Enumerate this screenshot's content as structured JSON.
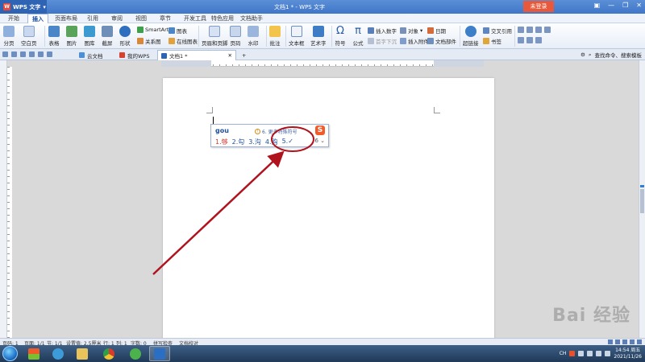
{
  "window": {
    "app_name": "WPS 文字",
    "title": "文档1 * - WPS 文字",
    "login_label": "未登录"
  },
  "ribbon_tabs": [
    "开始",
    "插入",
    "页面布局",
    "引用",
    "审阅",
    "视图",
    "章节",
    "开发工具",
    "特色应用",
    "文档助手"
  ],
  "active_tab": "插入",
  "ribbon": {
    "fenye": "分页",
    "kongbaiye": "空白页",
    "biaoge": "表格",
    "tupian": "图片",
    "tuku": "图库",
    "jieping": "截屏",
    "xingzhuang": "形状",
    "smartart": "SmartArt",
    "guanxitu": "关系图",
    "tubiao": "图表",
    "zaixiantubiao": "在线图表",
    "yemeiheyejiao": "页眉和页脚",
    "yema": "页码",
    "shuiyin": "水印",
    "pizhu": "批注",
    "wenbenkuang": "文本框",
    "yishuzi": "艺术字",
    "fuhao": "符号",
    "gongshi": "公式",
    "charushuzi": "插入数字",
    "shouzixiachen": "首字下沉",
    "duixiang": "对象",
    "charufujian": "插入附件",
    "riqi": "日期",
    "wendangbujian": "文档部件",
    "chaolianjie": "超链接",
    "jiaochayinyong": "交叉引用",
    "shuqian": "书签"
  },
  "quickbar": {
    "tabs": [
      "云文档",
      "我的WPS",
      "文档1 *"
    ],
    "search_label": "查找命令、搜索模板"
  },
  "ime": {
    "pinyin": "gou",
    "tip": "6. 更多特殊符号",
    "logo": "S",
    "candidates": [
      "1.够",
      "2.勾",
      "3.沟",
      "4.购",
      "5.✓"
    ],
    "more": "6 ⌄"
  },
  "status": {
    "page_no": "页码: 1",
    "pages": "页面: 1/1",
    "section": "节: 1/1",
    "setting": "设置值: 2.5厘米",
    "row": "行: 1",
    "col": "列: 1",
    "words": "字数: 0",
    "spellcheck": "拼写检查",
    "doccheck": "文档校对"
  },
  "taskbar": {
    "ime_mode": "CH",
    "time": "14:54 周五",
    "date": "2021/11/26"
  },
  "watermark": "Bai 经验",
  "colors": {
    "title_blue": "#3f76c7",
    "login_orange": "#e8593b",
    "annot_red": "#b0131d",
    "ime_blue": "#1d4f9e"
  }
}
